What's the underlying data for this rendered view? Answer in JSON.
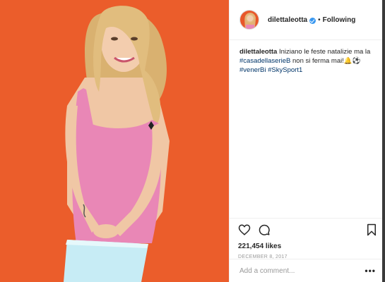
{
  "header": {
    "username": "dilettaleotta",
    "dot": "•",
    "follow_label": "Following"
  },
  "caption": {
    "username": "dilettaleotta",
    "text1": " Iniziano le feste natalizie ma la ",
    "tag1": "#casadellaserieB",
    "text2": " non si ferma mai!",
    "emoji": "🔔⚽",
    "tag2": "#venerBi",
    "tag3": "#SkySport1"
  },
  "actions": {
    "like_icon": "heart-icon",
    "comment_icon": "comment-icon",
    "save_icon": "bookmark-icon"
  },
  "likes": "221,454 likes",
  "date": "DECEMBER 8, 2017",
  "comment": {
    "placeholder": "Add a comment...",
    "more": "•••"
  },
  "colors": {
    "background_orange": "#e8572a",
    "dress_pink": "#e987b6",
    "link": "#003569",
    "verified": "#3897f0"
  }
}
